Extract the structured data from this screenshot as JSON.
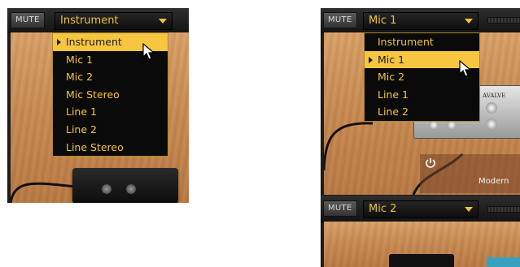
{
  "left": {
    "mute_label": "MUTE",
    "selected_value": "Instrument",
    "menu_items": [
      {
        "label": "Instrument",
        "highlighted": true
      },
      {
        "label": "Mic 1",
        "highlighted": false
      },
      {
        "label": "Mic 2",
        "highlighted": false
      },
      {
        "label": "Mic Stereo",
        "highlighted": false
      },
      {
        "label": "Line 1",
        "highlighted": false
      },
      {
        "label": "Line 2",
        "highlighted": false
      },
      {
        "label": "Line Stereo",
        "highlighted": false
      }
    ]
  },
  "right": {
    "top_strip": {
      "mute_label": "MUTE",
      "selected_value": "Mic 1",
      "menu_items": [
        {
          "label": "Instrument",
          "highlighted": false
        },
        {
          "label": "Mic 1",
          "highlighted": true
        },
        {
          "label": "Mic 2",
          "highlighted": false
        },
        {
          "label": "Line 1",
          "highlighted": false
        },
        {
          "label": "Line 2",
          "highlighted": false
        }
      ],
      "amp_label": "Modern",
      "device_text": "AVALVE"
    },
    "bottom_strip": {
      "mute_label": "MUTE",
      "selected_value": "Mic 2"
    }
  },
  "colors": {
    "accent": "#f0c23a",
    "highlight": "#f6c641",
    "menu_bg": "#0a0a0a",
    "strip_bg": "#1c1c1c",
    "wood": "#c98c55"
  },
  "icons": [
    "dropdown-arrow-icon",
    "selection-marker-icon",
    "mouse-cursor-icon",
    "power-icon",
    "cable",
    "amp-head"
  ]
}
